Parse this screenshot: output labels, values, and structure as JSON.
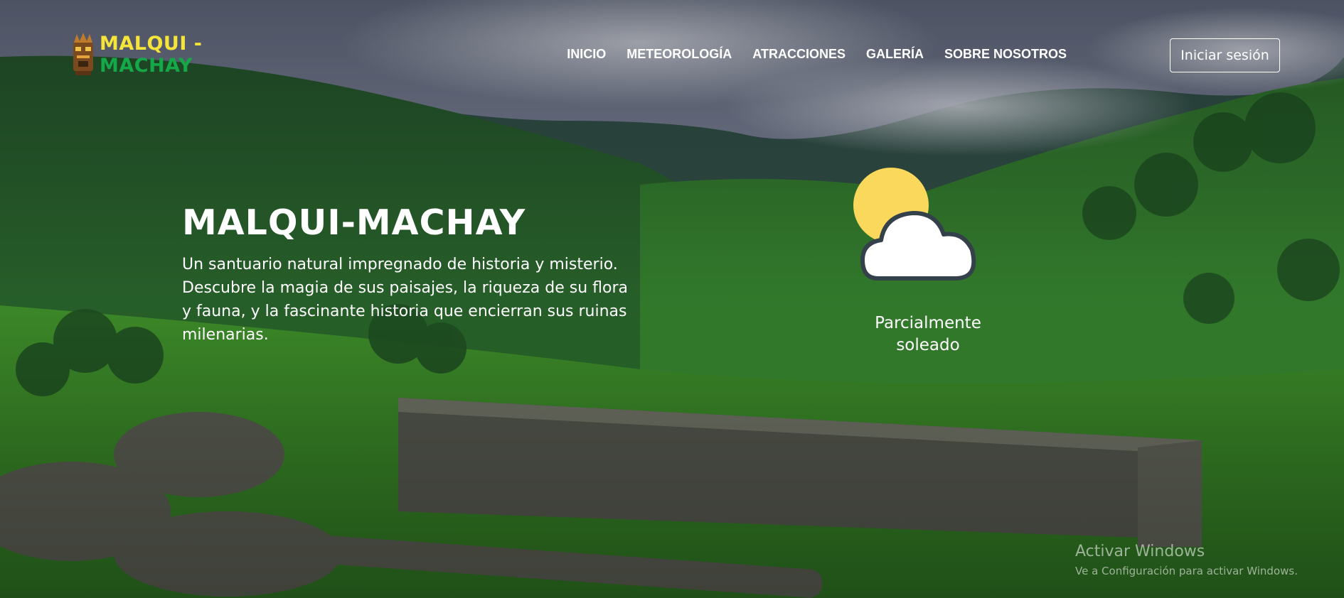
{
  "brand": {
    "line1": "MALQUI -",
    "line2": "MACHAY",
    "colors": {
      "line1": "#f5e43a",
      "line2": "#14a849"
    },
    "logo_icon": "totem-mask-icon"
  },
  "nav": {
    "items": [
      {
        "label": "INICIO"
      },
      {
        "label": "METEOROLOGÍA"
      },
      {
        "label": "ATRACCIONES"
      },
      {
        "label": "GALERÍA"
      },
      {
        "label": "SOBRE NOSOTROS"
      }
    ],
    "login_label": "Iniciar sesión"
  },
  "hero": {
    "title": "MALQUI-MACHAY",
    "description": "Un santuario natural impregnado de historia y misterio. Descubre la magia de sus paisajes, la riqueza de su flora y fauna, y la fascinante historia que encierran sus ruinas milenarias."
  },
  "weather": {
    "icon": "partly-sunny-icon",
    "condition_line1": "Parcialmente",
    "condition_line2": "soleado",
    "colors": {
      "sun": "#f9d85c",
      "cloud": "#ffffff",
      "cloud_outline": "#34404a"
    }
  },
  "watermark": {
    "title": "Activar Windows",
    "subtitle": "Ve a Configuración para activar Windows."
  }
}
